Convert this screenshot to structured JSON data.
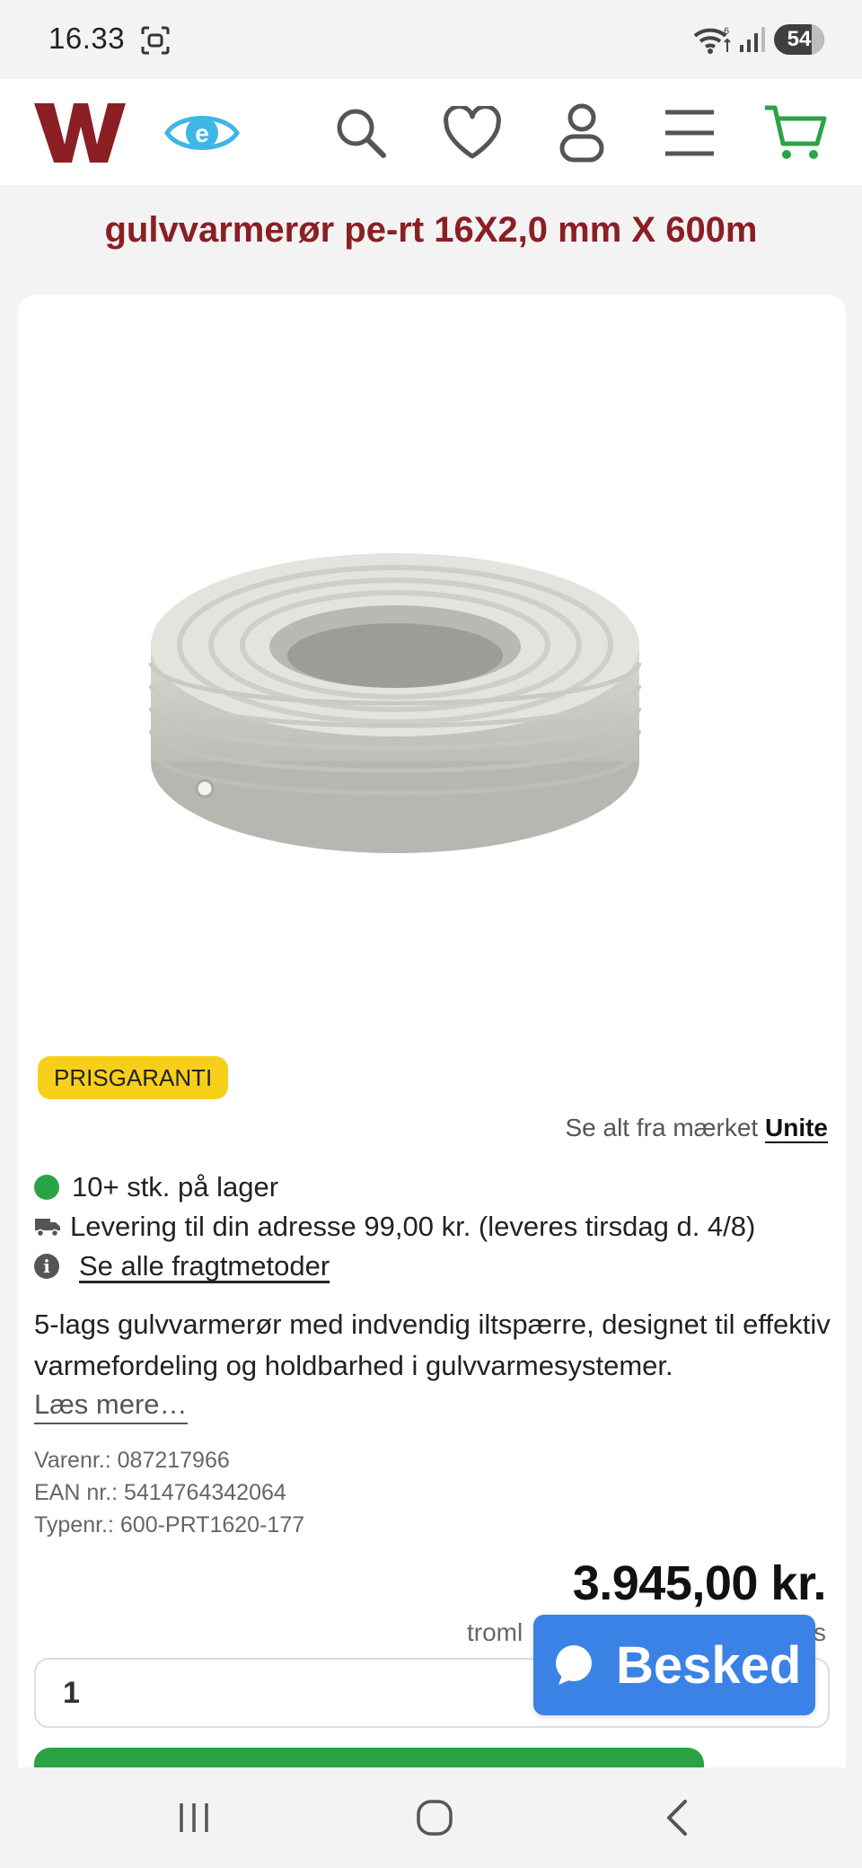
{
  "status_bar": {
    "time": "16.33",
    "battery": "54"
  },
  "header": {
    "logo_icon": "w-logo",
    "icons": [
      "eye-e-icon",
      "search-icon",
      "heart-icon",
      "user-icon",
      "menu-icon",
      "cart-icon"
    ],
    "brand_color": "#8b1f24",
    "accent_color": "#2aa345"
  },
  "product": {
    "title": "gulvvarmerør pe-rt 16X2,0 mm X 600m",
    "badge": "PRISGARANTI",
    "brand_prefix": "Se alt fra mærket",
    "brand_name": "Unite",
    "stock": "10+ stk. på lager",
    "delivery": "Levering til din adresse 99,00 kr. (leveres tirsdag d. 4/8)",
    "shipping_link": "Se alle fragtmetoder",
    "description": "5-lags gulvvarmerør med indvendig iltspærre, designet til effektiv varmefordeling og holdbarhed i gulvvarmesystemer.",
    "read_more": "Læs mere…",
    "item_no": "Varenr.: 087217966",
    "ean": "EAN nr.: 5414764342064",
    "type_no": "Typenr.: 600-PRT1620-177",
    "price": "3.945,00 kr.",
    "unit_left": "troml",
    "unit_right": "s",
    "quantity": "1"
  },
  "chat_button": {
    "label": "Besked",
    "color": "#3b82e6"
  },
  "nav": {
    "icons": [
      "recent-apps-icon",
      "home-icon",
      "back-icon"
    ]
  }
}
